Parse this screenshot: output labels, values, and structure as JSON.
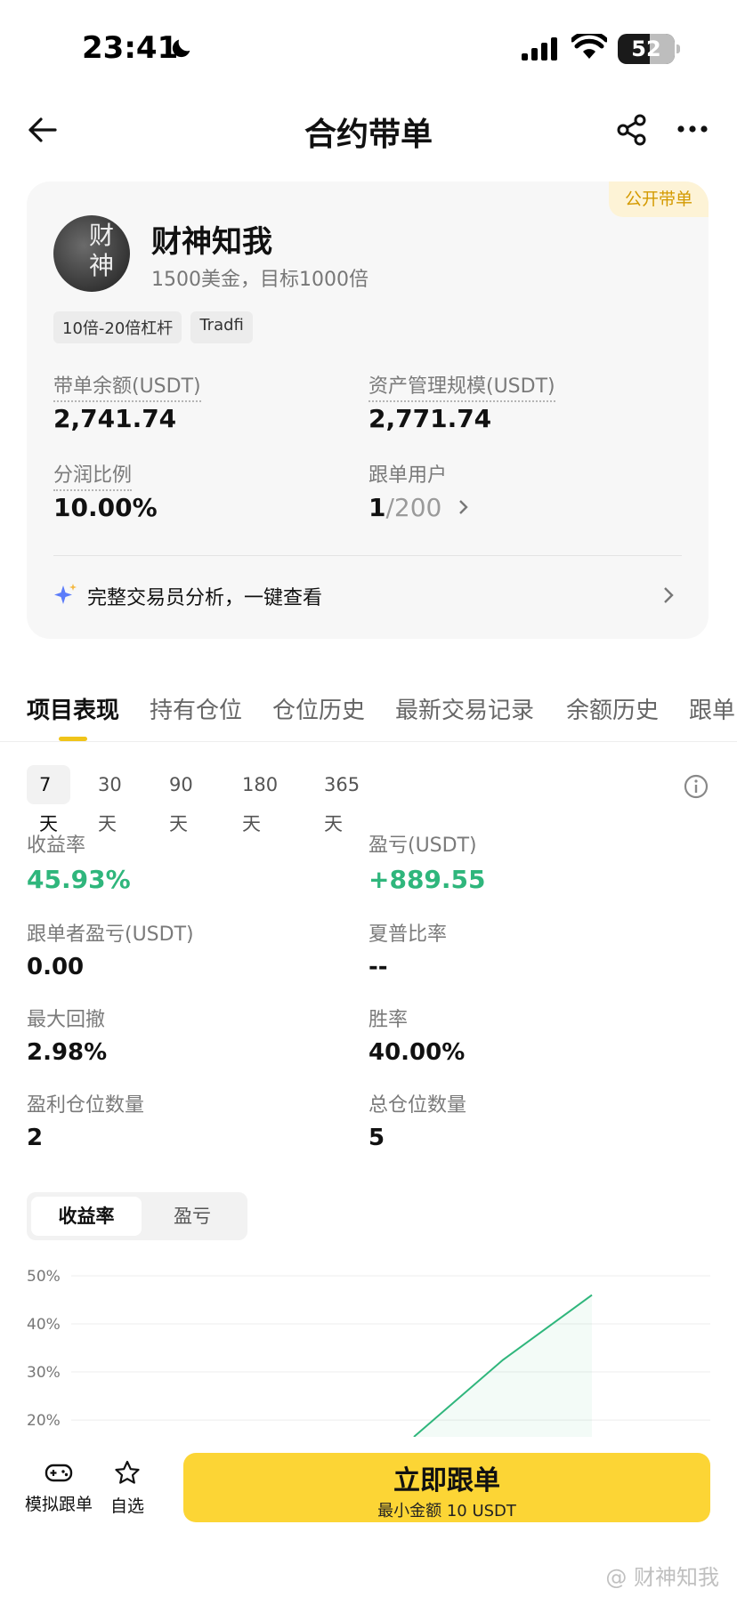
{
  "status_bar": {
    "time": "23:41",
    "battery": "52"
  },
  "nav": {
    "title": "合约带单"
  },
  "profile": {
    "badge": "公开带单",
    "avatar_text": "财神",
    "name": "财神知我",
    "description": "1500美金，目标1000倍",
    "tags": [
      "10倍-20倍杠杆",
      "Tradfi"
    ],
    "metrics": {
      "balance_label": "带单余额(USDT)",
      "balance_value": "2,741.74",
      "aum_label": "资产管理规模(USDT)",
      "aum_value": "2,771.74",
      "profit_share_label": "分润比例",
      "profit_share_value": "10.00%",
      "followers_label": "跟单用户",
      "followers_current": "1",
      "followers_capacity": "/200"
    },
    "analysis_text": "完整交易员分析，一键查看"
  },
  "tabs": [
    "项目表现",
    "持有仓位",
    "仓位历史",
    "最新交易记录",
    "余额历史",
    "跟单"
  ],
  "periods": [
    "7天",
    "30天",
    "90天",
    "180天",
    "365天"
  ],
  "stats": {
    "roi_label": "收益率",
    "roi_value": "45.93%",
    "pnl_label": "盈亏(USDT)",
    "pnl_value": "+889.55",
    "follower_pnl_label": "跟单者盈亏(USDT)",
    "follower_pnl_value": "0.00",
    "sharpe_label": "夏普比率",
    "sharpe_value": "--",
    "drawdown_label": "最大回撤",
    "drawdown_value": "2.98%",
    "winrate_label": "胜率",
    "winrate_value": "40.00%",
    "profit_positions_label": "盈利仓位数量",
    "profit_positions_value": "2",
    "total_positions_label": "总仓位数量",
    "total_positions_value": "5"
  },
  "chart_toggle": [
    "收益率",
    "盈亏"
  ],
  "chart_data": {
    "type": "line",
    "title": "",
    "xlabel": "",
    "ylabel": "",
    "y_ticks": [
      "50%",
      "40%",
      "30%",
      "20%"
    ],
    "y_tick_values": [
      50,
      40,
      30,
      20
    ],
    "ylim": [
      16.5,
      50
    ],
    "x": [
      5,
      6,
      7
    ],
    "values": [
      16.5,
      32.5,
      46
    ],
    "grid": true,
    "line_color": "#2fb67c"
  },
  "bottom_bar": {
    "demo_label": "模拟跟单",
    "watchlist_label": "自选",
    "follow_main": "立即跟单",
    "follow_sub": "最小金额 10 USDT",
    "watermark": "@ 财神知我"
  },
  "colors": {
    "accent": "#fcd535",
    "profit": "#2fb67c",
    "badge_text": "#d49a00"
  }
}
